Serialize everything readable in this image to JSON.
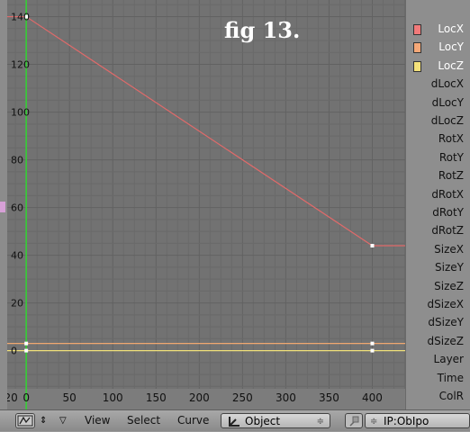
{
  "chart_data": {
    "type": "line",
    "title": "fig 13.",
    "xlabel": "",
    "ylabel": "",
    "xlim": [
      -22,
      438
    ],
    "ylim": [
      -16,
      147
    ],
    "x_ticks": [
      -20,
      0,
      50,
      100,
      150,
      200,
      250,
      300,
      350,
      400
    ],
    "y_ticks": [
      0,
      20,
      40,
      60,
      80,
      100,
      120,
      140
    ],
    "current_frame": 0,
    "grid": true,
    "series": [
      {
        "name": "LocX",
        "color": "#e06a6a",
        "points": [
          [
            -22,
            140
          ],
          [
            0,
            140
          ],
          [
            400,
            44
          ],
          [
            438,
            44
          ]
        ]
      },
      {
        "name": "LocY",
        "color": "#f0a870",
        "points": [
          [
            -22,
            3
          ],
          [
            0,
            3
          ],
          [
            400,
            3
          ],
          [
            438,
            3
          ]
        ]
      },
      {
        "name": "LocZ",
        "color": "#f0e07a",
        "points": [
          [
            -22,
            0
          ],
          [
            0,
            0
          ],
          [
            400,
            0
          ],
          [
            438,
            0
          ]
        ]
      }
    ]
  },
  "channels": [
    {
      "label": "LocX",
      "color": "#f27a7a"
    },
    {
      "label": "LocY",
      "color": "#f5a878"
    },
    {
      "label": "LocZ",
      "color": "#f5e17a"
    },
    {
      "label": "dLocX"
    },
    {
      "label": "dLocY"
    },
    {
      "label": "dLocZ"
    },
    {
      "label": "RotX"
    },
    {
      "label": "RotY"
    },
    {
      "label": "RotZ"
    },
    {
      "label": "dRotX"
    },
    {
      "label": "dRotY"
    },
    {
      "label": "dRotZ"
    },
    {
      "label": "SizeX"
    },
    {
      "label": "SizeY"
    },
    {
      "label": "SizeZ"
    },
    {
      "label": "dSizeX"
    },
    {
      "label": "dSizeY"
    },
    {
      "label": "dSizeZ"
    },
    {
      "label": "Layer"
    },
    {
      "label": "Time"
    },
    {
      "label": "ColR"
    }
  ],
  "header": {
    "window_type_icon": "ipo-curve-icon",
    "window_type_arrows": "⇕",
    "collapse_glyph": "▽",
    "menus": [
      "View",
      "Select",
      "Curve"
    ],
    "object_select": "Object",
    "object_select_icon": "object-axis-icon",
    "select_arrows": "≑",
    "pin_icon": "pin-icon",
    "ipo_block_name": "IP:ObIpo"
  }
}
